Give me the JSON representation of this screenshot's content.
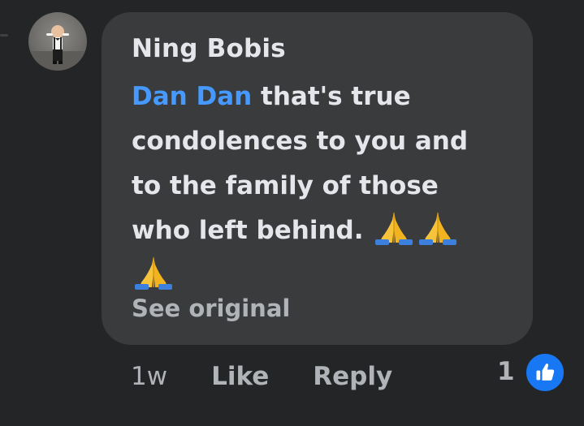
{
  "comment": {
    "author": "Ning Bobis",
    "mention": "Dan Dan",
    "text_line1": " that's true",
    "text_line2": "condolences to you and",
    "text_line3": "to the family of those",
    "text_line4": "who left behind. ",
    "emojis": [
      "folded-hands",
      "folded-hands",
      "folded-hands"
    ],
    "see_original_label": "See original"
  },
  "actions": {
    "timestamp": "1w",
    "like_label": "Like",
    "reply_label": "Reply"
  },
  "reactions": {
    "count": "1",
    "icon": "thumbs-up-icon"
  },
  "colors": {
    "background": "#242526",
    "bubble": "#3a3b3c",
    "text": "#e4e6eb",
    "secondary_text": "#b0b3b8",
    "mention": "#4599ff",
    "like_badge": "#1877f2"
  }
}
